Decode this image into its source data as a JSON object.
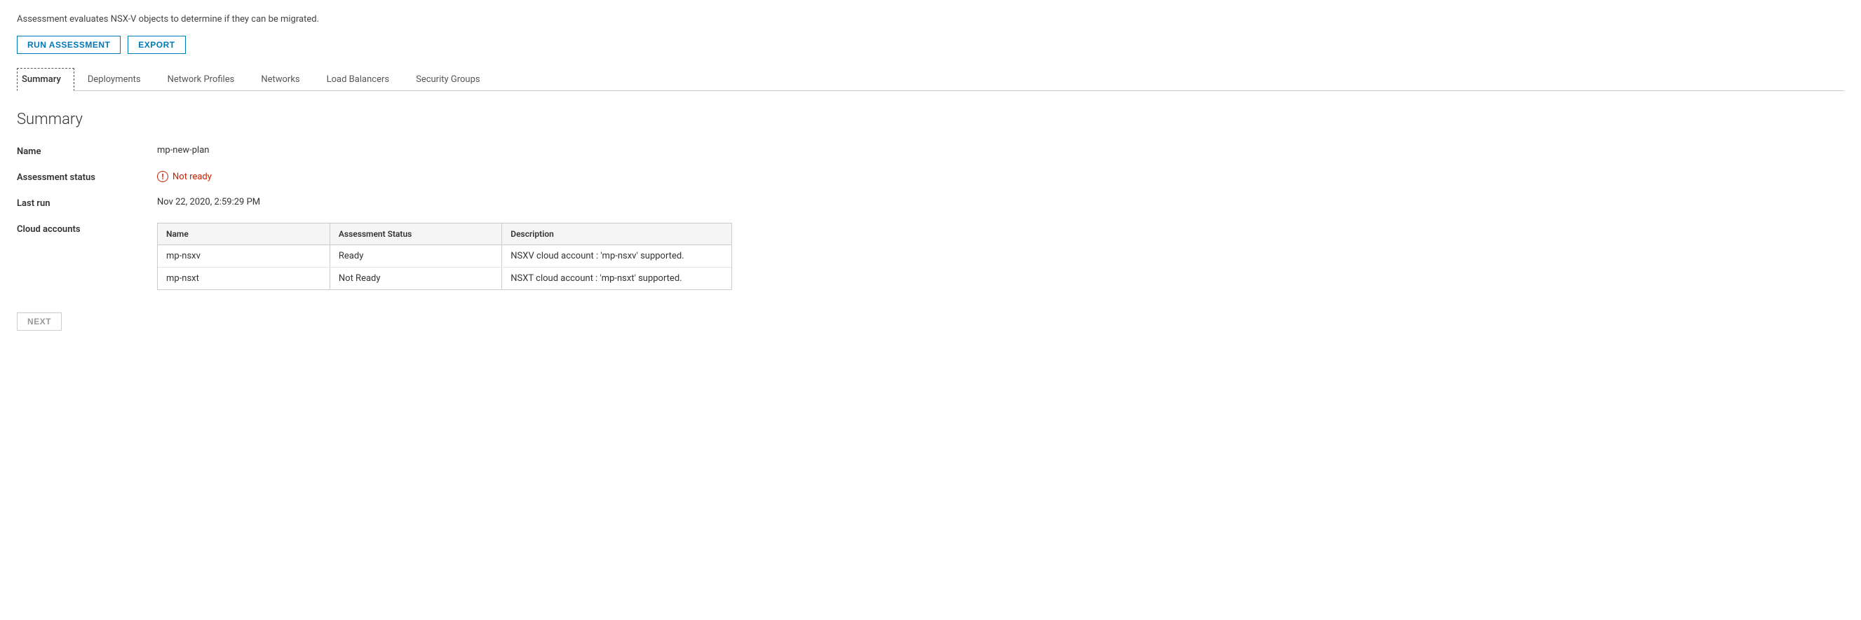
{
  "description": "Assessment evaluates NSX-V objects to determine if they can be migrated.",
  "toolbar": {
    "run_assessment_label": "RUN ASSESSMENT",
    "export_label": "EXPORT"
  },
  "tabs": [
    {
      "id": "summary",
      "label": "Summary",
      "active": true
    },
    {
      "id": "deployments",
      "label": "Deployments",
      "active": false
    },
    {
      "id": "network-profiles",
      "label": "Network Profiles",
      "active": false
    },
    {
      "id": "networks",
      "label": "Networks",
      "active": false
    },
    {
      "id": "load-balancers",
      "label": "Load Balancers",
      "active": false
    },
    {
      "id": "security-groups",
      "label": "Security Groups",
      "active": false
    }
  ],
  "section": {
    "title": "Summary",
    "fields": {
      "name_label": "Name",
      "name_value": "mp-new-plan",
      "assessment_status_label": "Assessment status",
      "assessment_status_value": "Not ready",
      "last_run_label": "Last run",
      "last_run_value": "Nov 22, 2020, 2:59:29 PM",
      "cloud_accounts_label": "Cloud accounts"
    },
    "table": {
      "columns": [
        {
          "id": "name",
          "label": "Name"
        },
        {
          "id": "assessment_status",
          "label": "Assessment Status"
        },
        {
          "id": "description",
          "label": "Description"
        }
      ],
      "rows": [
        {
          "name": "mp-nsxv",
          "assessment_status": "Ready",
          "description": "NSXV cloud account : 'mp-nsxv' supported."
        },
        {
          "name": "mp-nsxt",
          "assessment_status": "Not Ready",
          "description": "NSXT cloud account : 'mp-nsxt' supported."
        }
      ]
    }
  },
  "footer": {
    "next_label": "NEXT"
  }
}
